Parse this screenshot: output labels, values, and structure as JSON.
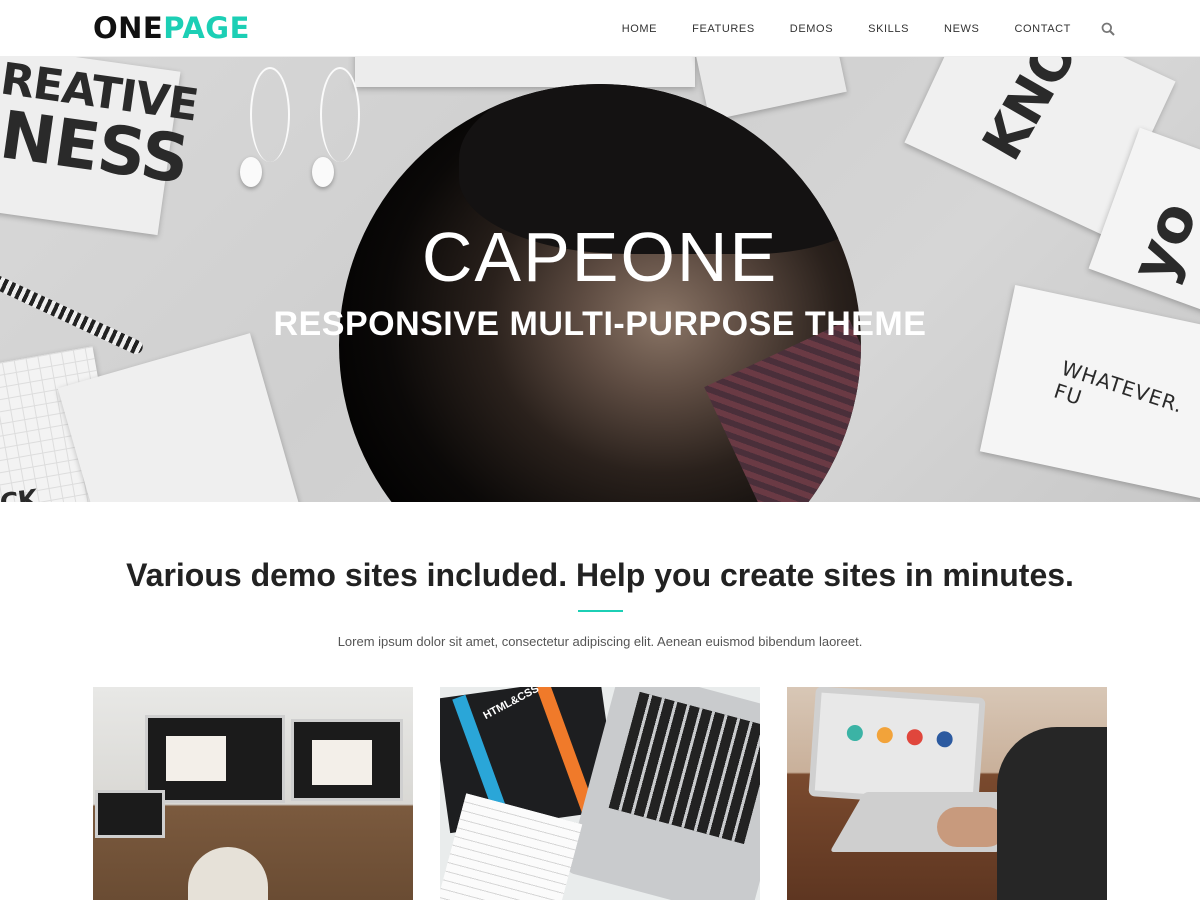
{
  "header": {
    "logo_part1": "ONE",
    "logo_part2": "PAGE",
    "nav": [
      "HOME",
      "FEATURES",
      "DEMOS",
      "SKILLS",
      "NEWS",
      "CONTACT"
    ],
    "search_icon": "search-icon"
  },
  "hero": {
    "title": "CAPEONE",
    "subtitle": "RESPONSIVE MULTI-PURPOSE THEME",
    "background_words": [
      "REATIVE",
      "NESS",
      "KNO",
      "yo",
      "WHATEVER. FU",
      "CK"
    ]
  },
  "section": {
    "title": "Various demo sites included. Help you create sites in minutes.",
    "text": "Lorem ipsum dolor sit amet, consectetur adipiscing elit. Aenean euismod bibendum laoreet.",
    "thumbnail_book_label": "HTML&CSS"
  },
  "colors": {
    "accent": "#1ccfb5",
    "logo_dark": "#111111",
    "hero_text": "#ffffff"
  }
}
